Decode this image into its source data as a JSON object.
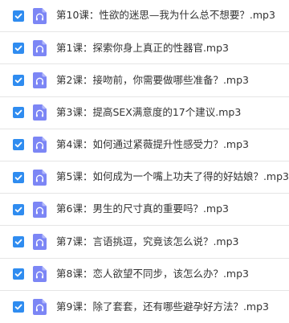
{
  "file_list": {
    "items": [
      {
        "name": "第10课：性欲的迷思—我为什么总不想要？.mp3",
        "checked": true,
        "icon": "audio-file-icon"
      },
      {
        "name": "第1课：探索你身上真正的性器官.mp3",
        "checked": true,
        "icon": "audio-file-icon"
      },
      {
        "name": "第2课：接吻前，你需要做哪些准备？.mp3",
        "checked": true,
        "icon": "audio-file-icon"
      },
      {
        "name": "第3课：提高SEX满意度的17个建议.mp3",
        "checked": true,
        "icon": "audio-file-icon"
      },
      {
        "name": "第4课：如何通过紧薇提升性感受力？.mp3",
        "checked": true,
        "icon": "audio-file-icon"
      },
      {
        "name": "第5课：如何成为一个嘴上功夫了得的好姑娘？.mp3",
        "checked": true,
        "icon": "audio-file-icon"
      },
      {
        "name": "第6课：男生的尺寸真的重要吗？.mp3",
        "checked": true,
        "icon": "audio-file-icon"
      },
      {
        "name": "第7课：言语挑逗，究竟该怎么说？.mp3",
        "checked": true,
        "icon": "audio-file-icon"
      },
      {
        "name": "第8课：恋人欲望不同步，该怎么办？.mp3",
        "checked": true,
        "icon": "audio-file-icon"
      },
      {
        "name": "第9课：除了套套，还有哪些避孕好方法？.mp3",
        "checked": true,
        "icon": "audio-file-icon"
      }
    ]
  },
  "colors": {
    "checkbox": "#2f8cf0",
    "icon": "#7c86f5",
    "text": "#333333",
    "divider": "#e5e5e5"
  }
}
